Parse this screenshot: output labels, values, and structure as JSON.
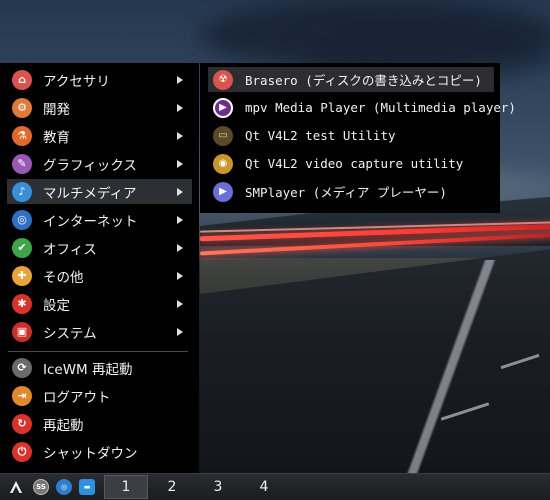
{
  "menu": {
    "items": [
      {
        "label": "アクセサリ",
        "icon": "accessories-icon",
        "color": "#d9534f",
        "glyph": "⌂",
        "submenu": true
      },
      {
        "label": "開発",
        "icon": "development-icon",
        "color": "#e07b39",
        "glyph": "⚙",
        "submenu": true
      },
      {
        "label": "教育",
        "icon": "education-icon",
        "color": "#e06a2c",
        "glyph": "⚗",
        "submenu": true
      },
      {
        "label": "グラフィックス",
        "icon": "graphics-icon",
        "color": "#9b59b6",
        "glyph": "✎",
        "submenu": true
      },
      {
        "label": "マルチメディア",
        "icon": "multimedia-icon",
        "color": "#3a8fd9",
        "glyph": "♪",
        "submenu": true
      },
      {
        "label": "インターネット",
        "icon": "internet-icon",
        "color": "#2f6fc4",
        "glyph": "◎",
        "submenu": true
      },
      {
        "label": "オフィス",
        "icon": "office-icon",
        "color": "#3fa54a",
        "glyph": "✔",
        "submenu": true
      },
      {
        "label": "その他",
        "icon": "other-icon",
        "color": "#e8a33a",
        "glyph": "✚",
        "submenu": true
      },
      {
        "label": "設定",
        "icon": "settings-icon",
        "color": "#d9342b",
        "glyph": "✱",
        "submenu": true
      },
      {
        "label": "システム",
        "icon": "system-icon",
        "color": "#c9302c",
        "glyph": "▣",
        "submenu": true
      }
    ],
    "actions": [
      {
        "label": "IceWM 再起動",
        "icon": "restart-wm-icon",
        "color": "#6a6a6a",
        "glyph": "⟳"
      },
      {
        "label": "ログアウト",
        "icon": "logout-icon",
        "color": "#e08a2c",
        "glyph": "⇥"
      },
      {
        "label": "再起動",
        "icon": "reboot-icon",
        "color": "#d9342b",
        "glyph": "↻"
      },
      {
        "label": "シャットダウン",
        "icon": "shutdown-icon",
        "color": "#d9342b",
        "glyph": "⏻"
      }
    ]
  },
  "submenu": {
    "items": [
      {
        "label": "Brasero (ディスクの書き込みとコピー)",
        "icon": "brasero-icon",
        "color": "#d9534f",
        "glyph": "☢"
      },
      {
        "label": "mpv Media Player (Multimedia player)",
        "icon": "mpv-icon",
        "color": "#6b2f8a",
        "glyph": "▶"
      },
      {
        "label": "Qt V4L2 test Utility",
        "icon": "qv4l2-test-icon",
        "color": "#5a4a2a",
        "glyph": "▭"
      },
      {
        "label": "Qt V4L2 video capture utility",
        "icon": "qv4l2-capture-icon",
        "color": "#c8962a",
        "glyph": "◉"
      },
      {
        "label": "SMPlayer (メディア プレーヤー)",
        "icon": "smplayer-icon",
        "color": "#6a6fd8",
        "glyph": "▶"
      }
    ]
  },
  "taskbar": {
    "workspaces": [
      "1",
      "2",
      "3",
      "4"
    ],
    "quick_launch": [
      {
        "icon": "screenshot-icon",
        "color": "#777777",
        "glyph": "SS"
      },
      {
        "icon": "web-browser-icon",
        "color": "#2f7fd0",
        "glyph": "◎"
      },
      {
        "icon": "file-manager-icon",
        "color": "#2f8fe0",
        "glyph": "▬"
      }
    ]
  }
}
